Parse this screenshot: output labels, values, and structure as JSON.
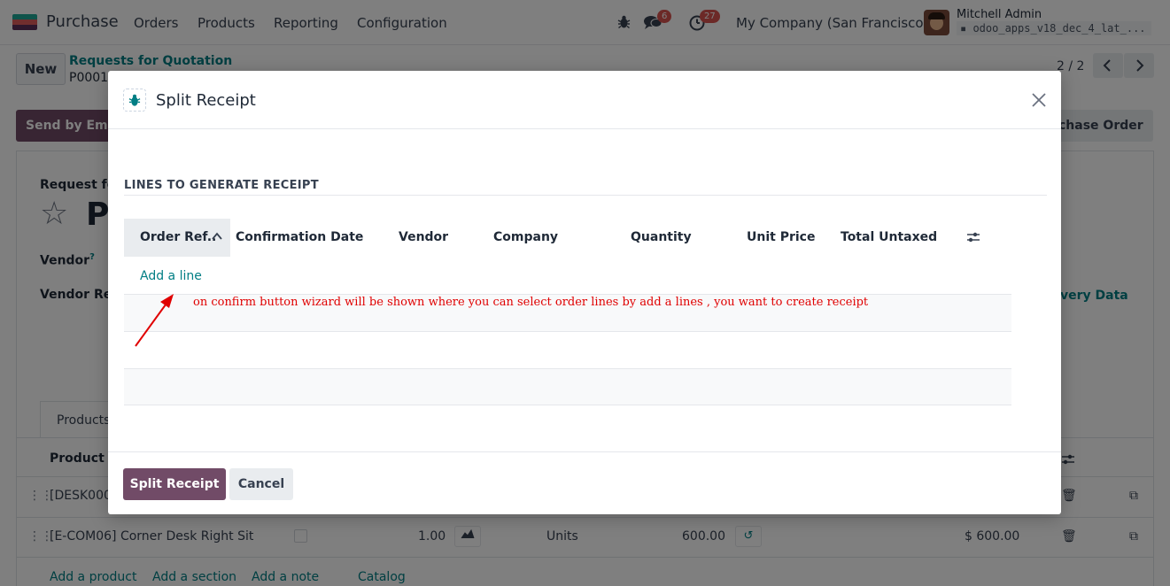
{
  "navbar": {
    "app_name": "Purchase",
    "menus": [
      "Orders",
      "Products",
      "Reporting",
      "Configuration"
    ],
    "messages_count": "6",
    "activities_count": "27",
    "company": "My Company (San Francisco)",
    "user_name": "Mitchell Admin",
    "database": "odoo_apps_v18_dec_4_lat_..."
  },
  "background": {
    "new_button": "New",
    "breadcrumb_parent": "Requests for Quotation",
    "record_ref": "P0001",
    "pager": "2 / 2",
    "send_email": "Send by Email",
    "confirm_order": "Confirm Order",
    "confirm_order_visible": "chase Order",
    "request_for_label": "Request for Quotation",
    "request_for_visible": "Request fo",
    "title_initial": "P",
    "vendor_label": "Vendor",
    "vendor_help": "?",
    "vendor_ref_label": "Vendor Reference",
    "vendor_ref_visible": "Vendor Re",
    "delivery_tab_visible": "very Data",
    "products_tab_visible": "Products",
    "product_col": "Product",
    "row1_desc_visible": "[DESK000",
    "row2_desc": "[E-COM06] Corner Desk Right Sit",
    "row2_qty": "1.00",
    "row2_uom": "Units",
    "row2_price": "600.00",
    "row2_subtotal": "$ 600.00",
    "add_product": "Add a product",
    "add_section": "Add a section",
    "add_note": "Add a note",
    "catalog": "Catalog"
  },
  "dialog": {
    "title": "Split Receipt",
    "section_title": "LINES TO GENERATE RECEIPT",
    "columns": [
      "Order Ref..",
      "Confirmation Date",
      "Vendor",
      "Company",
      "Quantity",
      "Unit Price",
      "Total Untaxed"
    ],
    "add_line": "Add a line",
    "annotation": "on confirm button wizard will be shown where you can select order lines by add a lines , you want to create receipt",
    "split_button": "Split Receipt",
    "cancel_button": "Cancel"
  },
  "colors": {
    "brand": "#714b67",
    "link": "#017e84",
    "annotation": "#e00000"
  }
}
